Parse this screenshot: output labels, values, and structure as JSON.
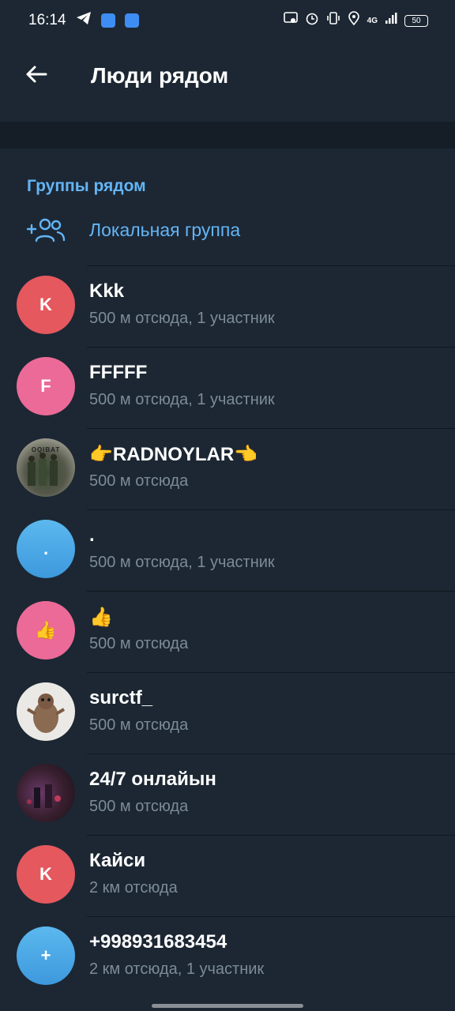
{
  "status": {
    "time": "16:14",
    "network": "4G",
    "battery": "50"
  },
  "header": {
    "title": "Люди рядом"
  },
  "section": {
    "title": "Группы рядом"
  },
  "local_group": {
    "label": "Локальная группа"
  },
  "groups": [
    {
      "name": "Kkk",
      "subtitle": "500 м отсюда, 1 участник",
      "initial": "K",
      "color": "#e5585e"
    },
    {
      "name": "FFFFF",
      "subtitle": "500 м отсюда, 1 участник",
      "initial": "F",
      "color": "#ec6a97"
    },
    {
      "name": "👉RADNOYLAR👈",
      "subtitle": "500 м отсюда",
      "initial": "OQIBAT",
      "color": "#5a5a4e"
    },
    {
      "name": ".",
      "subtitle": "500 м отсюда, 1 участник",
      "initial": ".",
      "color": "#4ea8e6"
    },
    {
      "name": "👍",
      "subtitle": "500 м отсюда",
      "initial": "👍",
      "color": "#ec6a97"
    },
    {
      "name": "surctf_",
      "subtitle": "500 м отсюда",
      "initial": "",
      "color": "#ebe9e6"
    },
    {
      "name": "24/7 онлайын",
      "subtitle": "500 м отсюда",
      "initial": "",
      "color": "#3a2030"
    },
    {
      "name": "Кайси",
      "subtitle": "2 км отсюда",
      "initial": "K",
      "color": "#e5585e"
    },
    {
      "name": "+998931683454",
      "subtitle": "2 км отсюда, 1 участник",
      "initial": "+",
      "color": "#4ea8e6"
    }
  ]
}
